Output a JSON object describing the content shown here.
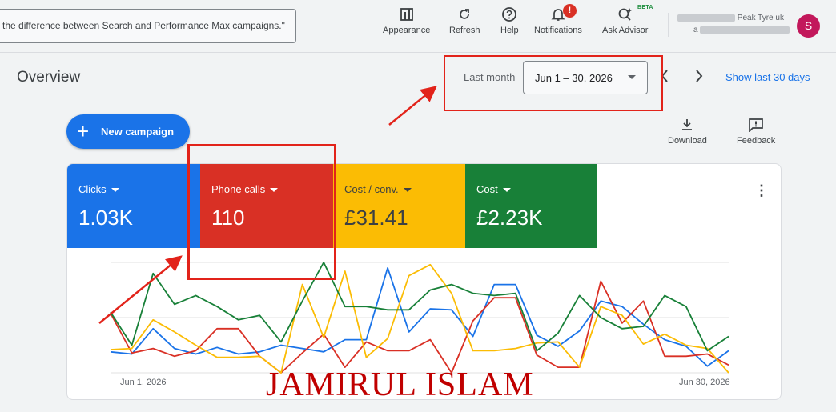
{
  "topbar": {
    "search_text": "the difference between Search and Performance Max campaigns.\"",
    "tools": [
      {
        "label": "Appearance",
        "icon": "appearance-icon"
      },
      {
        "label": "Refresh",
        "icon": "refresh-icon"
      },
      {
        "label": "Help",
        "icon": "help-icon"
      },
      {
        "label": "Notifications",
        "icon": "bell-icon",
        "badge": "!"
      },
      {
        "label": "Ask Advisor",
        "icon": "advisor-icon",
        "tag": "BETA"
      }
    ],
    "account_name": "Peak Tyre uk",
    "account_email_fragment": "a",
    "avatar_letter": "S"
  },
  "overview": {
    "title": "Overview",
    "date_label": "Last month",
    "date_range": "Jun 1 – 30, 2026",
    "show_last": "Show last 30 days"
  },
  "actions": {
    "new_campaign": "New campaign",
    "download": "Download",
    "feedback": "Feedback"
  },
  "tiles": [
    {
      "label": "Clicks",
      "value": "1.03K",
      "color": "#1a73e8"
    },
    {
      "label": "Phone calls",
      "value": "110",
      "color": "#d93025"
    },
    {
      "label": "Cost / conv.",
      "value": "£31.41",
      "color": "#fbbc04"
    },
    {
      "label": "Cost",
      "value": "£2.23K",
      "color": "#188038"
    }
  ],
  "chart_data": {
    "type": "line",
    "x": [
      "Jun 1",
      "Jun 2",
      "Jun 3",
      "Jun 4",
      "Jun 5",
      "Jun 6",
      "Jun 7",
      "Jun 8",
      "Jun 9",
      "Jun 10",
      "Jun 11",
      "Jun 12",
      "Jun 13",
      "Jun 14",
      "Jun 15",
      "Jun 16",
      "Jun 17",
      "Jun 18",
      "Jun 19",
      "Jun 20",
      "Jun 21",
      "Jun 22",
      "Jun 23",
      "Jun 24",
      "Jun 25",
      "Jun 26",
      "Jun 27",
      "Jun 28",
      "Jun 29",
      "Jun 30"
    ],
    "xtick_labels": [
      "Jun 1, 2026",
      "Jun 30, 2026"
    ],
    "ylim": [
      0,
      100
    ],
    "grid": true,
    "series": [
      {
        "name": "Clicks",
        "color": "#1a73e8",
        "values": [
          19,
          17,
          40,
          22,
          17,
          23,
          17,
          19,
          25,
          22,
          19,
          30,
          30,
          95,
          37,
          58,
          57,
          33,
          80,
          80,
          34,
          24,
          38,
          65,
          60,
          44,
          30,
          24,
          6,
          20
        ]
      },
      {
        "name": "Phone calls",
        "color": "#d93025",
        "values": [
          54,
          18,
          22,
          15,
          20,
          40,
          40,
          15,
          0,
          18,
          35,
          5,
          28,
          20,
          20,
          30,
          0,
          47,
          68,
          68,
          16,
          5,
          5,
          83,
          45,
          65,
          15,
          15,
          17,
          7
        ]
      },
      {
        "name": "Cost / conv.",
        "color": "#fbbc04",
        "values": [
          21,
          22,
          48,
          37,
          25,
          14,
          14,
          15,
          0,
          80,
          32,
          92,
          14,
          31,
          88,
          98,
          72,
          20,
          20,
          22,
          27,
          28,
          5,
          60,
          52,
          26,
          35,
          25,
          22,
          0
        ]
      },
      {
        "name": "Cost",
        "color": "#188038",
        "values": [
          55,
          25,
          90,
          62,
          70,
          60,
          48,
          52,
          28,
          65,
          100,
          60,
          60,
          57,
          57,
          75,
          80,
          72,
          70,
          72,
          20,
          36,
          70,
          50,
          40,
          42,
          70,
          60,
          20,
          33
        ]
      }
    ]
  },
  "chart_labels": {
    "x_start": "Jun 1, 2026",
    "x_end": "Jun 30, 2026"
  },
  "watermark": "JAMIRUL ISLAM"
}
